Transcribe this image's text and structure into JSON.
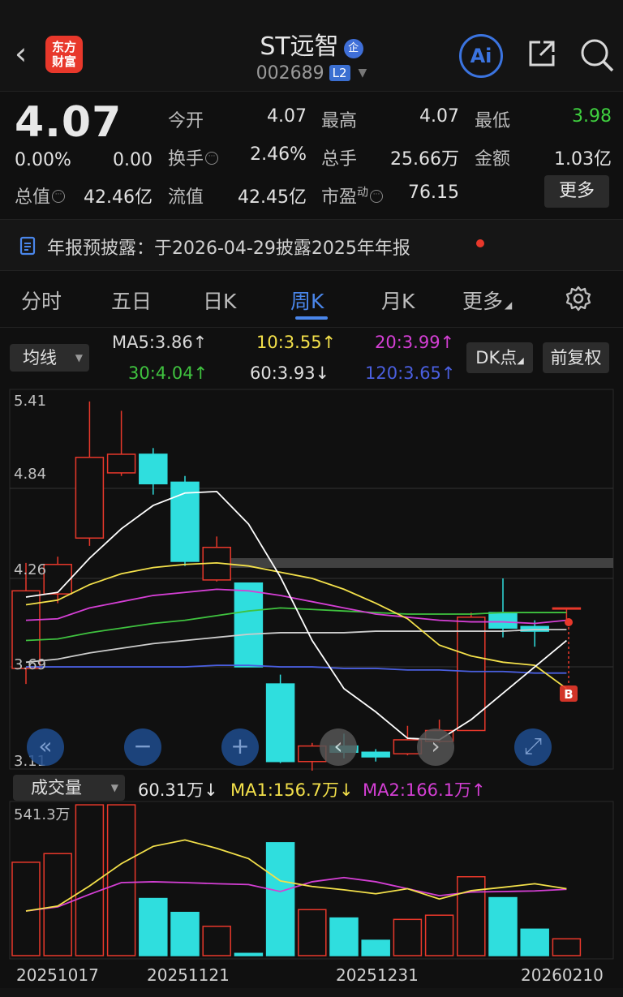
{
  "header": {
    "back": "‹",
    "logo_line1": "东方",
    "logo_line2": "财富",
    "stock_name": "ST远智",
    "ent_badge": "企",
    "code": "002689",
    "level": "L2",
    "ai": "Ai"
  },
  "quote": {
    "price": "4.07",
    "change_pct": "0.00%",
    "change": "0.00",
    "rows": [
      [
        {
          "label": "今开",
          "value": "4.07"
        },
        {
          "label": "最高",
          "value": "4.07"
        },
        {
          "label": "最低",
          "value": "3.98"
        }
      ],
      [
        {
          "label": "换手",
          "value": "2.46%"
        },
        {
          "label": "总手",
          "value": "25.66万"
        },
        {
          "label": "金额",
          "value": "1.03亿"
        }
      ],
      [
        {
          "label": "流值",
          "value": "42.45亿"
        },
        {
          "label": "市盈",
          "value": "76.15"
        }
      ]
    ],
    "total_value_label": "总值",
    "total_value": "42.46亿",
    "pe_superscript": "动",
    "more": "更多",
    "low_color": "#3fd13f"
  },
  "notice": {
    "text": "年报预披露：于2026-04-29披露2025年年报"
  },
  "tabs": [
    "分时",
    "五日",
    "日K",
    "周K",
    "月K",
    "更多"
  ],
  "active_tab": "周K",
  "ma_controls": {
    "selector": "均线",
    "dk": "DK点",
    "adjust": "前复权",
    "values": [
      {
        "text": "MA5:3.86↑",
        "color": "#ffffff"
      },
      {
        "text": "10:3.55↑",
        "color": "#f3e04a"
      },
      {
        "text": "20:3.99↑",
        "color": "#d43fd4"
      },
      {
        "text": "30:4.04↑",
        "color": "#3fc23f"
      },
      {
        "text": "60:3.93↓",
        "color": "#e0e0e0"
      },
      {
        "text": "120:3.65↑",
        "color": "#4a5fe0"
      }
    ]
  },
  "volume_controls": {
    "selector": "成交量",
    "current": "60.31万↓",
    "ma1": "MA1:156.7万↓",
    "ma2": "MA2:166.1万↑"
  },
  "chart_data": [
    {
      "type": "candlestick",
      "y_ticks": [
        "5.41",
        "4.84",
        "4.26",
        "3.69",
        "3.11"
      ],
      "ylim": [
        3.11,
        5.41
      ],
      "candles": [
        {
          "open": 3.68,
          "close": 4.18,
          "high": 4.36,
          "low": 3.58
        },
        {
          "open": 4.16,
          "close": 4.35,
          "high": 4.4,
          "low": 4.1
        },
        {
          "open": 4.52,
          "close": 5.04,
          "high": 5.4,
          "low": 4.47
        },
        {
          "open": 4.94,
          "close": 5.06,
          "high": 5.34,
          "low": 4.92
        },
        {
          "open": 5.06,
          "close": 4.87,
          "high": 5.1,
          "low": 4.8
        },
        {
          "open": 4.88,
          "close": 4.37,
          "high": 4.92,
          "low": 4.34
        },
        {
          "open": 4.25,
          "close": 4.46,
          "high": 4.53,
          "low": 4.24
        },
        {
          "open": 4.23,
          "close": 3.69,
          "high": 4.23,
          "low": 3.69
        },
        {
          "open": 3.58,
          "close": 3.08,
          "high": 3.64,
          "low": 3.07
        },
        {
          "open": 3.08,
          "close": 3.18,
          "high": 3.2,
          "low": 3.02
        },
        {
          "open": 3.18,
          "close": 3.14,
          "high": 3.26,
          "low": 3.1
        },
        {
          "open": 3.14,
          "close": 3.11,
          "high": 3.16,
          "low": 3.08
        },
        {
          "open": 3.13,
          "close": 3.22,
          "high": 3.31,
          "low": 3.12
        },
        {
          "open": 3.21,
          "close": 3.28,
          "high": 3.35,
          "low": 3.2
        },
        {
          "open": 3.28,
          "close": 4.01,
          "high": 4.04,
          "low": 3.28
        },
        {
          "open": 4.04,
          "close": 3.94,
          "high": 4.26,
          "low": 3.88
        },
        {
          "open": 3.95,
          "close": 3.92,
          "high": 3.99,
          "low": 3.82
        },
        {
          "open": 4.07,
          "close": 4.07,
          "high": 4.07,
          "low": 3.98
        }
      ],
      "ma5": [
        4.14,
        4.17,
        4.39,
        4.58,
        4.73,
        4.81,
        4.82,
        4.61,
        4.27,
        3.86,
        3.55,
        3.4,
        3.23,
        3.22,
        3.35,
        3.52,
        3.69,
        3.86
      ],
      "ma10": [
        4.09,
        4.12,
        4.22,
        4.29,
        4.33,
        4.35,
        4.36,
        4.34,
        4.3,
        4.26,
        4.19,
        4.1,
        4.0,
        3.83,
        3.76,
        3.72,
        3.7,
        3.55
      ],
      "ma20": [
        3.99,
        4.0,
        4.07,
        4.11,
        4.15,
        4.17,
        4.19,
        4.18,
        4.15,
        4.11,
        4.07,
        4.03,
        4.01,
        3.99,
        3.98,
        3.98,
        3.97,
        3.99
      ],
      "ma30": [
        3.86,
        3.87,
        3.91,
        3.94,
        3.97,
        3.99,
        4.02,
        4.05,
        4.07,
        4.06,
        4.05,
        4.04,
        4.03,
        4.03,
        4.03,
        4.04,
        4.04,
        4.04
      ],
      "ma60": [
        3.72,
        3.74,
        3.78,
        3.81,
        3.84,
        3.86,
        3.88,
        3.9,
        3.91,
        3.91,
        3.91,
        3.92,
        3.92,
        3.92,
        3.92,
        3.92,
        3.93,
        3.93
      ],
      "ma120": [
        3.69,
        3.69,
        3.69,
        3.69,
        3.69,
        3.69,
        3.7,
        3.7,
        3.69,
        3.69,
        3.68,
        3.68,
        3.67,
        3.67,
        3.66,
        3.66,
        3.65,
        3.65
      ]
    },
    {
      "type": "bar",
      "y_max_label": "541.3万",
      "ylim": [
        0,
        541.3
      ],
      "values": [
        335,
        366,
        541,
        541,
        205,
        155,
        105,
        8,
        405,
        165,
        135,
        55,
        130,
        145,
        283,
        208,
        95,
        60.31
      ],
      "rising": [
        true,
        true,
        true,
        true,
        false,
        false,
        true,
        false,
        false,
        true,
        false,
        false,
        true,
        true,
        true,
        false,
        false,
        true
      ],
      "ma1": [
        160,
        178,
        250,
        330,
        392,
        415,
        385,
        348,
        268,
        248,
        236,
        222,
        240,
        203,
        233,
        245,
        258,
        240
      ],
      "ma2": [
        160,
        175,
        220,
        262,
        265,
        262,
        258,
        255,
        230,
        265,
        280,
        265,
        240,
        215,
        228,
        230,
        232,
        238
      ]
    }
  ],
  "dates": [
    "20251017",
    "20251121",
    "20251231",
    "20260210"
  ],
  "colors": {
    "up": "#e8382b",
    "down": "#2fdede",
    "ma5": "#ffffff",
    "ma10": "#f3e04a",
    "ma20": "#d43fd4",
    "ma30": "#3fc23f",
    "ma60": "#cccccc",
    "ma120": "#4a5fe0"
  },
  "nav": {
    "scroll_left": "«",
    "zoom_out": "−",
    "zoom_in": "+",
    "prev": "‹",
    "next": "›",
    "fullscreen": "⤢"
  },
  "marker": "B"
}
